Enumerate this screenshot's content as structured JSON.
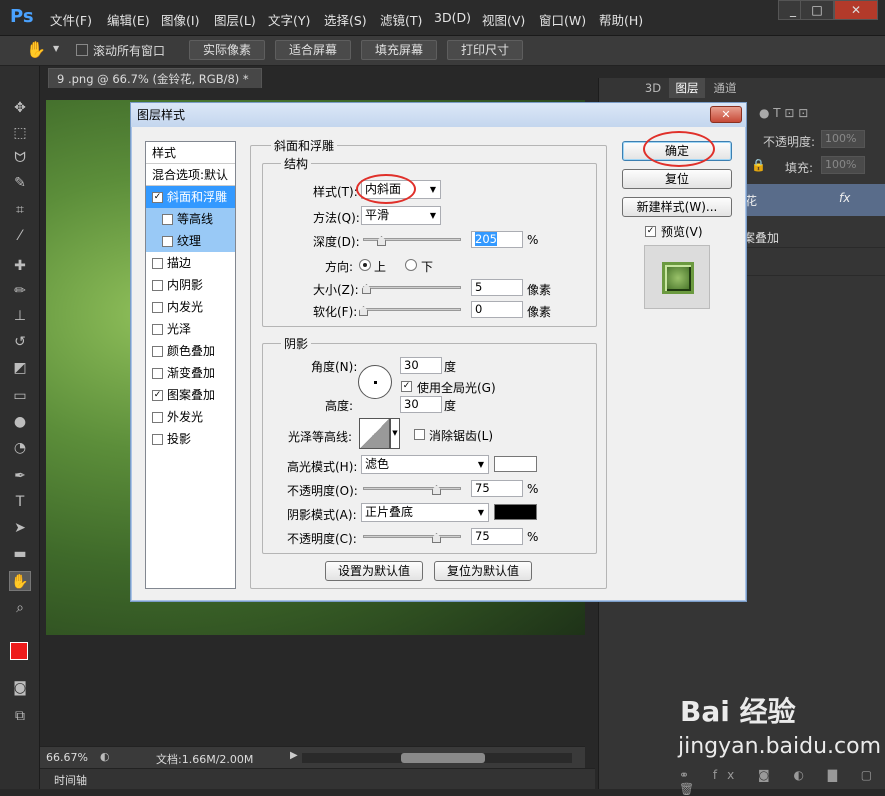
{
  "app": {
    "logo": "Ps",
    "menu": [
      "文件(F)",
      "编辑(E)",
      "图像(I)",
      "图层(L)",
      "文字(Y)",
      "选择(S)",
      "滤镜(T)",
      "3D(D)",
      "视图(V)",
      "窗口(W)",
      "帮助(H)"
    ],
    "window_controls": [
      "_",
      "□",
      "✕"
    ]
  },
  "options_bar": {
    "scroll_all_label": "滚动所有窗口",
    "buttons": [
      "实际像素",
      "适合屏幕",
      "填充屏幕",
      "打印尺寸"
    ]
  },
  "document": {
    "tab_title": "9 .png @ 66.7% (金铃花, RGB/8) *",
    "zoom": "66.67%",
    "doc_size": "文档:1.66M/2.00M",
    "timeline_label": "时间轴"
  },
  "right_panel": {
    "tabs": [
      "3D",
      "图层",
      "通道"
    ],
    "opacity_label": "不透明度:",
    "opacity_value": "100%",
    "fill_label": "填充:",
    "fill_value": "100%",
    "layer_fx": "fx",
    "layer_effect_partial": "案叠加",
    "layer_name_partial": "花"
  },
  "watermark": {
    "brand": "Bai 经验",
    "url": "jingyan.baidu.com"
  },
  "dialog": {
    "title": "图层样式",
    "close": "✕",
    "styles_header": "样式",
    "blend_options": "混合选项:默认",
    "style_items": [
      {
        "label": "斜面和浮雕",
        "checked": true
      },
      {
        "label": "等高线",
        "checked": false
      },
      {
        "label": "纹理",
        "checked": false
      },
      {
        "label": "描边",
        "checked": false
      },
      {
        "label": "内阴影",
        "checked": false
      },
      {
        "label": "内发光",
        "checked": false
      },
      {
        "label": "光泽",
        "checked": false
      },
      {
        "label": "颜色叠加",
        "checked": false
      },
      {
        "label": "渐变叠加",
        "checked": false
      },
      {
        "label": "图案叠加",
        "checked": true
      },
      {
        "label": "外发光",
        "checked": false
      },
      {
        "label": "投影",
        "checked": false
      }
    ],
    "bevel_group": "斜面和浮雕",
    "structure": {
      "group": "结构",
      "style_label": "样式(T):",
      "style_value": "内斜面",
      "technique_label": "方法(Q):",
      "technique_value": "平滑",
      "depth_label": "深度(D):",
      "depth_value": "205",
      "depth_unit": "%",
      "direction_label": "方向:",
      "direction_up": "上",
      "direction_down": "下",
      "size_label": "大小(Z):",
      "size_value": "5",
      "size_unit": "像素",
      "soften_label": "软化(F):",
      "soften_value": "0",
      "soften_unit": "像素"
    },
    "shading": {
      "group": "阴影",
      "angle_label": "角度(N):",
      "angle_value": "30",
      "angle_unit": "度",
      "global_light": "使用全局光(G)",
      "altitude_label": "高度:",
      "altitude_value": "30",
      "altitude_unit": "度",
      "gloss_label": "光泽等高线:",
      "anti_alias": "消除锯齿(L)",
      "highlight_mode_label": "高光模式(H):",
      "highlight_mode_value": "滤色",
      "highlight_color": "#ffffff",
      "highlight_opacity_label": "不透明度(O):",
      "highlight_opacity_value": "75",
      "shadow_mode_label": "阴影模式(A):",
      "shadow_mode_value": "正片叠底",
      "shadow_color": "#000000",
      "shadow_opacity_label": "不透明度(C):",
      "shadow_opacity_value": "75",
      "percent": "%"
    },
    "make_default": "设置为默认值",
    "reset_default": "复位为默认值",
    "ok": "确定",
    "reset": "复位",
    "new_style": "新建样式(W)...",
    "preview_label": "预览(V)"
  }
}
